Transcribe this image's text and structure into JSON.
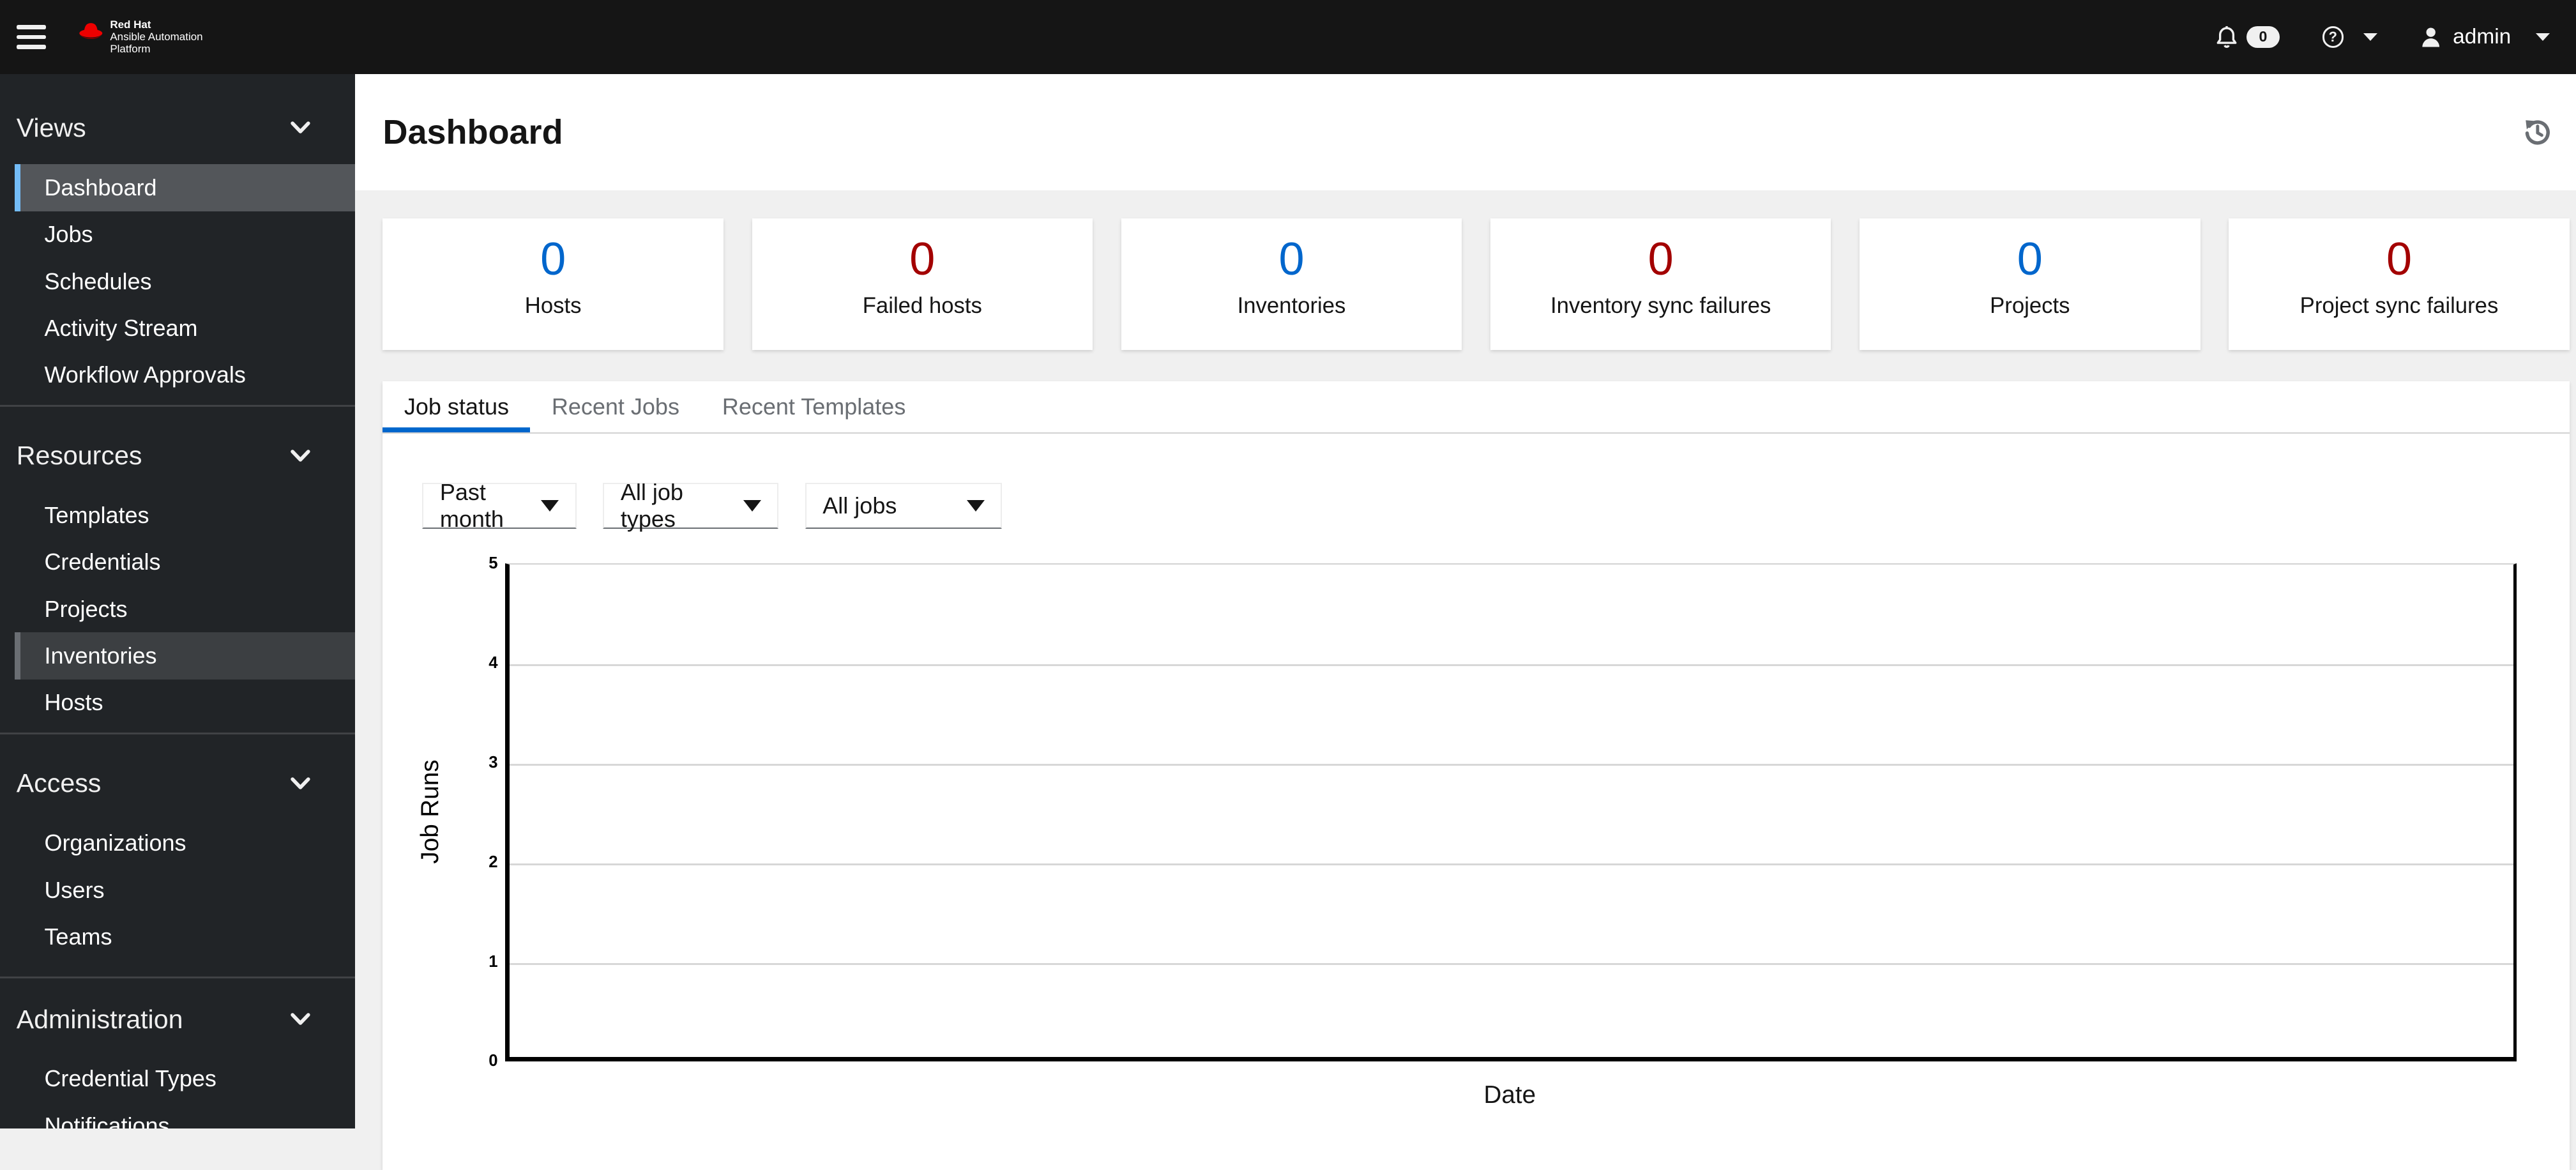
{
  "navbar": {
    "brand": {
      "line1": "Red Hat",
      "line2": "Ansible Automation",
      "line3": "Platform"
    },
    "notifications_count": "0",
    "help_glyph": "?",
    "user_name": "admin"
  },
  "sidebar": {
    "groups": [
      {
        "label": "Views",
        "items": [
          {
            "label": "Dashboard",
            "state": "current"
          },
          {
            "label": "Jobs"
          },
          {
            "label": "Schedules"
          },
          {
            "label": "Activity Stream"
          },
          {
            "label": "Workflow Approvals"
          }
        ]
      },
      {
        "label": "Resources",
        "items": [
          {
            "label": "Templates"
          },
          {
            "label": "Credentials"
          },
          {
            "label": "Projects"
          },
          {
            "label": "Inventories",
            "state": "hover"
          },
          {
            "label": "Hosts"
          }
        ]
      },
      {
        "label": "Access",
        "items": [
          {
            "label": "Organizations"
          },
          {
            "label": "Users"
          },
          {
            "label": "Teams"
          }
        ]
      },
      {
        "label": "Administration",
        "items": [
          {
            "label": "Credential Types"
          },
          {
            "label": "Notifications"
          }
        ]
      }
    ]
  },
  "page": {
    "title": "Dashboard"
  },
  "summary_cards": [
    {
      "value": "0",
      "label": "Hosts",
      "color": "#0066cc"
    },
    {
      "value": "0",
      "label": "Failed hosts",
      "color": "#a30000"
    },
    {
      "value": "0",
      "label": "Inventories",
      "color": "#0066cc"
    },
    {
      "value": "0",
      "label": "Inventory sync failures",
      "color": "#a30000"
    },
    {
      "value": "0",
      "label": "Projects",
      "color": "#0066cc"
    },
    {
      "value": "0",
      "label": "Project sync failures",
      "color": "#a30000"
    }
  ],
  "tabs": [
    {
      "label": "Job status",
      "active": true
    },
    {
      "label": "Recent Jobs",
      "active": false
    },
    {
      "label": "Recent Templates",
      "active": false
    }
  ],
  "filters": [
    {
      "value": "Past month"
    },
    {
      "value": "All job types"
    },
    {
      "value": "All jobs"
    }
  ],
  "chart_data": {
    "type": "line",
    "title": "Job status",
    "xlabel": "Date",
    "ylabel": "Job Runs",
    "ylim": [
      0,
      5
    ],
    "yticks": [
      "0",
      "1",
      "2",
      "3",
      "4",
      "5"
    ],
    "grid": true,
    "series": []
  },
  "colors": {
    "masthead_bg": "#151515",
    "sidebar_bg": "#212427",
    "active_tab_accent": "#0066cc",
    "current_nav_accent": "#73bcf7",
    "page_bg": "#f0f0f0"
  }
}
